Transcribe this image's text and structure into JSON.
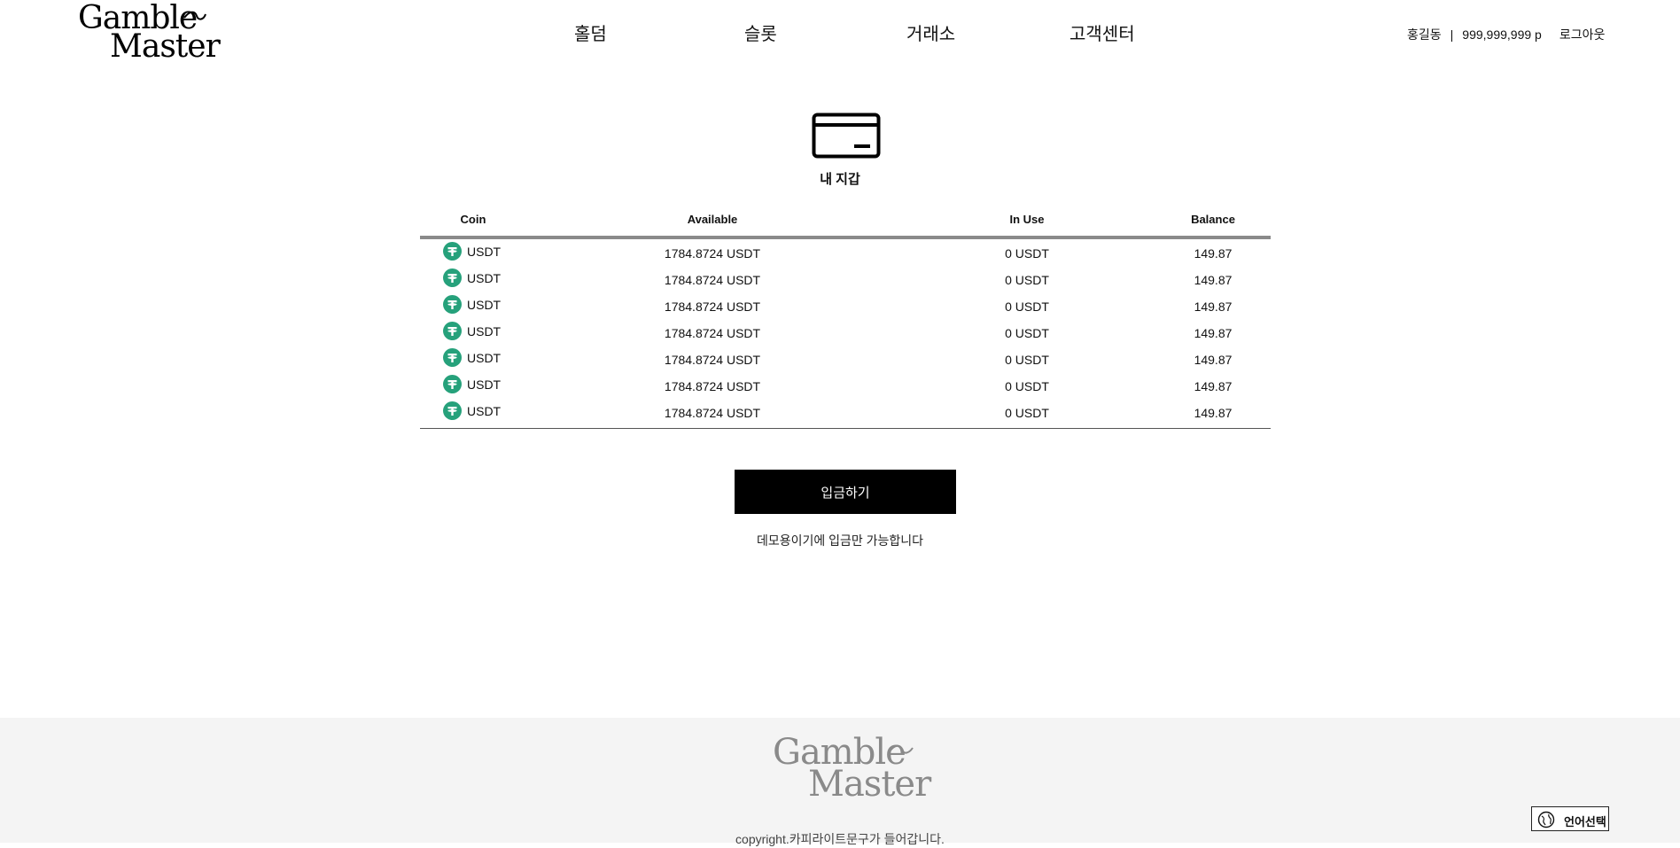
{
  "brand": {
    "logo_line1": "Gamble",
    "logo_line2": "Master"
  },
  "nav": {
    "items": [
      {
        "label": "홀덤"
      },
      {
        "label": "슬롯"
      },
      {
        "label": "거래소"
      },
      {
        "label": "고객센터"
      }
    ]
  },
  "user": {
    "name": "홍길동",
    "separator": "|",
    "points": "999,999,999 p",
    "logout_label": "로그아웃"
  },
  "wallet": {
    "icon": "credit-card-icon",
    "title": "내 지갑",
    "columns": {
      "coin": "Coin",
      "available": "Available",
      "in_use": "In Use",
      "balance": "Balance"
    },
    "rows": [
      {
        "coin": "USDT",
        "available": "1784.8724 USDT",
        "in_use": "0 USDT",
        "balance": "149.87"
      },
      {
        "coin": "USDT",
        "available": "1784.8724 USDT",
        "in_use": "0 USDT",
        "balance": "149.87"
      },
      {
        "coin": "USDT",
        "available": "1784.8724 USDT",
        "in_use": "0 USDT",
        "balance": "149.87"
      },
      {
        "coin": "USDT",
        "available": "1784.8724 USDT",
        "in_use": "0 USDT",
        "balance": "149.87"
      },
      {
        "coin": "USDT",
        "available": "1784.8724 USDT",
        "in_use": "0 USDT",
        "balance": "149.87"
      },
      {
        "coin": "USDT",
        "available": "1784.8724 USDT",
        "in_use": "0 USDT",
        "balance": "149.87"
      },
      {
        "coin": "USDT",
        "available": "1784.8724 USDT",
        "in_use": "0 USDT",
        "balance": "149.87"
      }
    ],
    "coin_icon": "tether-icon",
    "coin_color": "#26a17b",
    "deposit_label": "입금하기",
    "notice": "데모용이기에 입금만 가능합니다"
  },
  "footer": {
    "logo_line1": "Gamble",
    "logo_line2": "Master",
    "copyright": "copyright.카피라이트문구가 들어갑니다.",
    "language_label": "언어선택",
    "language_icon": "globe-icon"
  }
}
